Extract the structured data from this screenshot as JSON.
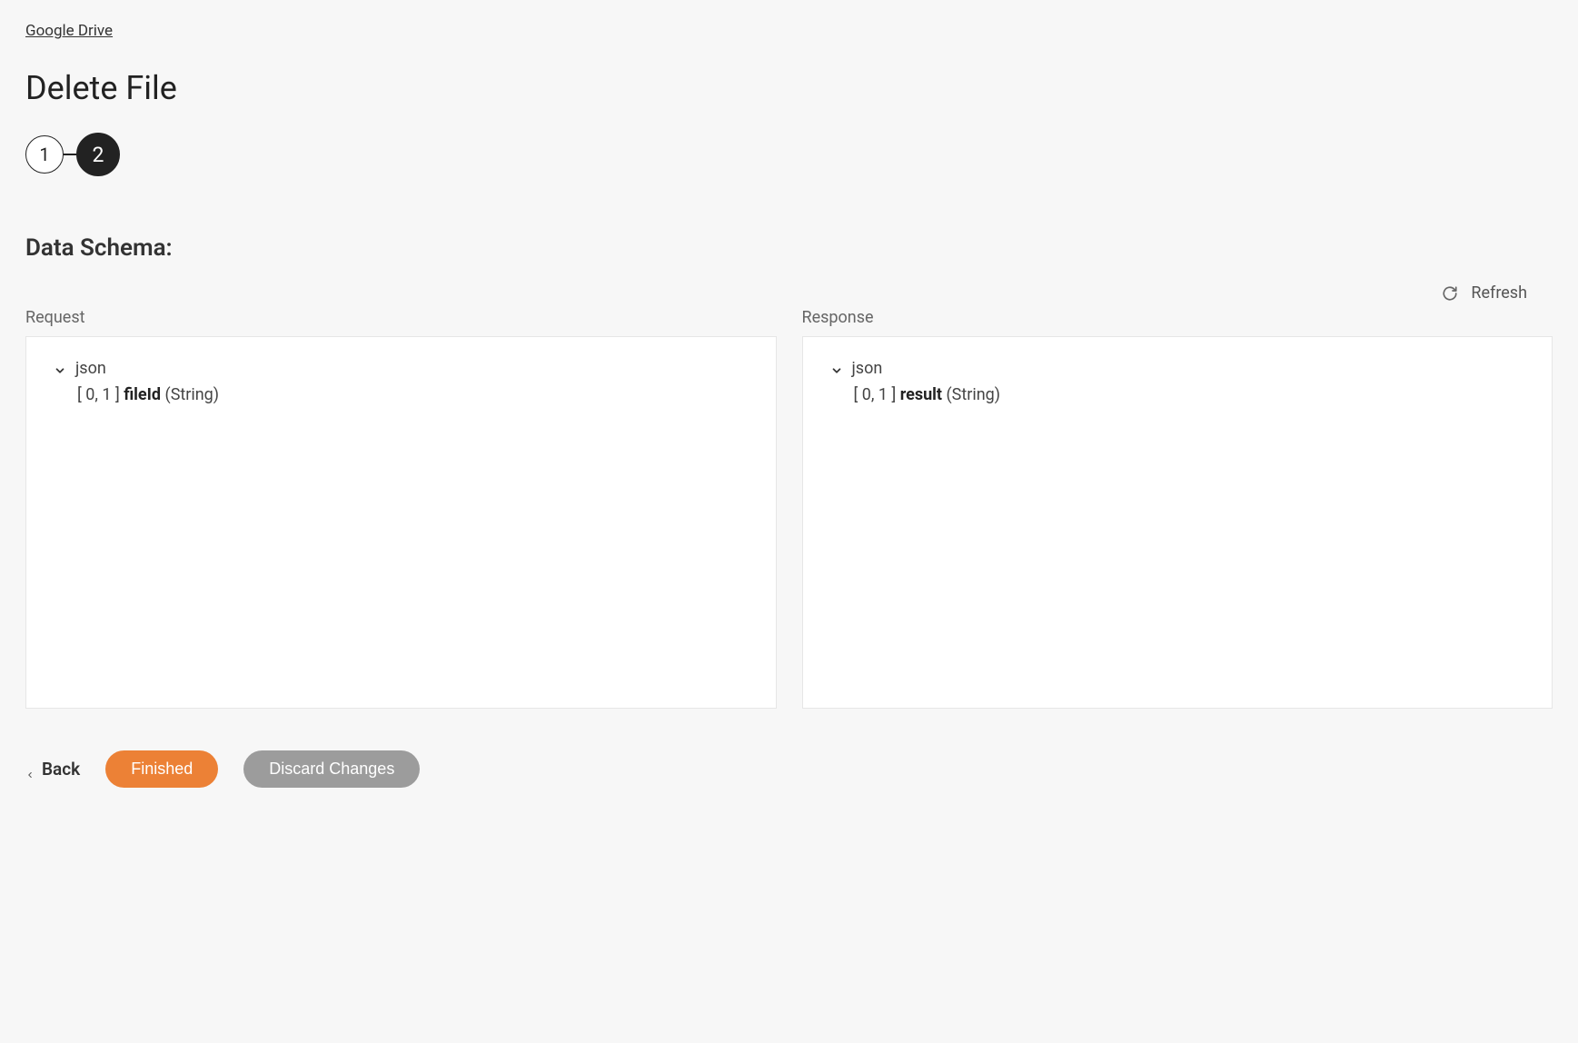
{
  "breadcrumb": {
    "label": "Google Drive"
  },
  "page": {
    "title": "Delete File"
  },
  "stepper": {
    "steps": [
      "1",
      "2"
    ],
    "activeIndex": 1
  },
  "section": {
    "heading": "Data Schema:"
  },
  "refresh": {
    "label": "Refresh"
  },
  "request": {
    "label": "Request",
    "root_label": "json",
    "field": {
      "cardinality": "[ 0, 1 ]",
      "name": "fileId",
      "type": "(String)"
    }
  },
  "response": {
    "label": "Response",
    "root_label": "json",
    "field": {
      "cardinality": "[ 0, 1 ]",
      "name": "result",
      "type": "(String)"
    }
  },
  "footer": {
    "back": "Back",
    "finished": "Finished",
    "discard": "Discard Changes"
  }
}
